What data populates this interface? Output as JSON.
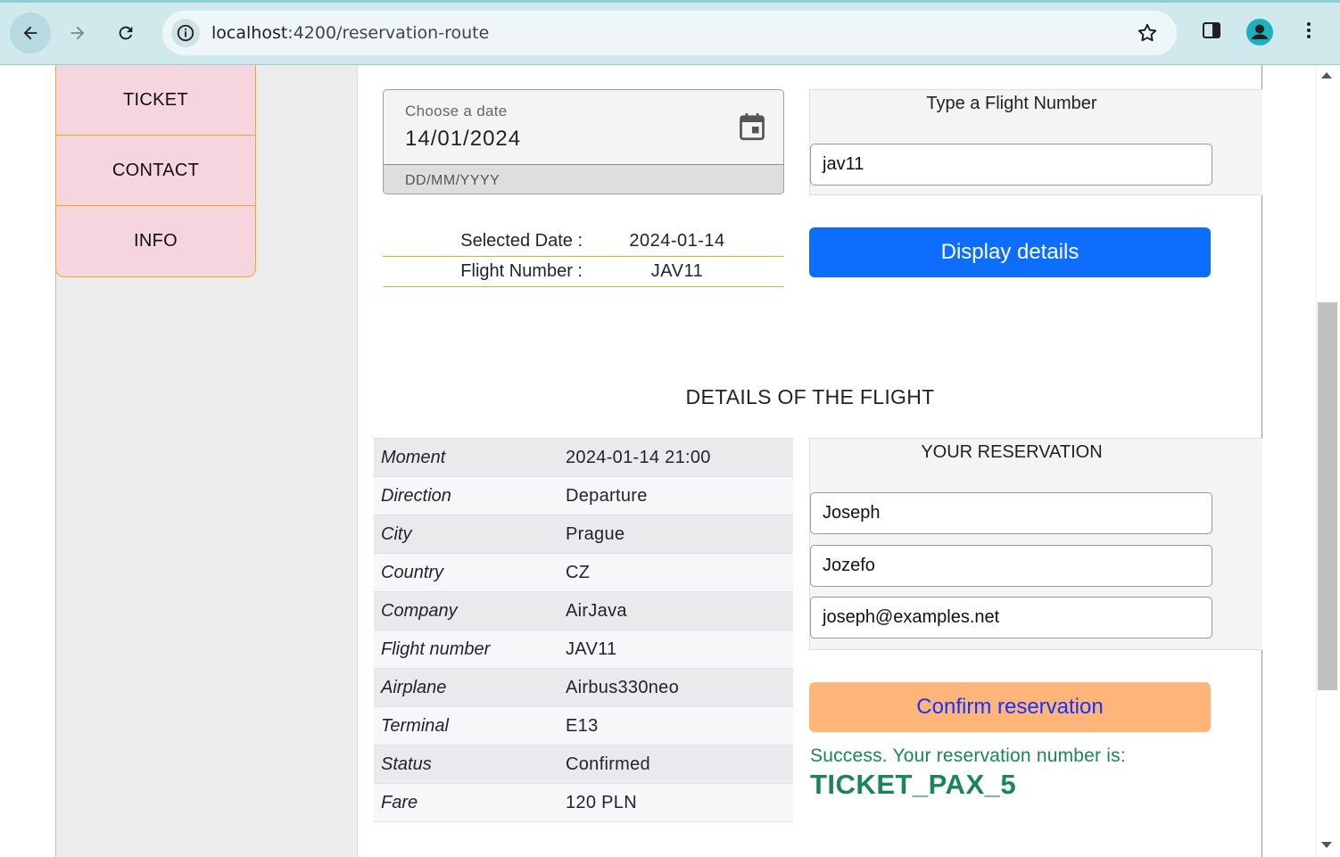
{
  "browser": {
    "url_host": "localhost",
    "url_path": ":4200/reservation-route"
  },
  "menu": {
    "items": [
      "TICKET",
      "CONTACT",
      "INFO"
    ]
  },
  "date_field": {
    "label": "Choose a date",
    "value": "14/01/2024",
    "hint": "DD/MM/YYYY"
  },
  "flight_search": {
    "title": "Type a Flight Number",
    "value": "jav11"
  },
  "summary": {
    "selected_date_label": "Selected Date :",
    "selected_date_value": "2024-01-14",
    "flight_number_label": "Flight Number :",
    "flight_number_value": "JAV11"
  },
  "display_button": "Display details",
  "details_title": "DETAILS OF THE FLIGHT",
  "details": [
    {
      "key": "Moment",
      "value": "2024-01-14 21:00"
    },
    {
      "key": "Direction",
      "value": "Departure"
    },
    {
      "key": "City",
      "value": "Prague"
    },
    {
      "key": "Country",
      "value": "CZ"
    },
    {
      "key": "Company",
      "value": "AirJava"
    },
    {
      "key": "Flight number",
      "value": "JAV11"
    },
    {
      "key": "Airplane",
      "value": "Airbus330neo"
    },
    {
      "key": "Terminal",
      "value": "E13"
    },
    {
      "key": "Status",
      "value": "Confirmed"
    },
    {
      "key": "Fare",
      "value": "120 PLN"
    }
  ],
  "reservation": {
    "title": "YOUR RESERVATION",
    "first_name": "Joseph",
    "last_name": "Jozefo",
    "email": "joseph@examples.net"
  },
  "confirm_button": "Confirm reservation",
  "success_message": "Success. Your reservation number is:",
  "ticket_number": "TICKET_PAX_5",
  "colors": {
    "primary_button": "#0d6efd",
    "confirm_button": "#ffb479",
    "success": "#198754",
    "menu_bg": "#f5d6df",
    "accent_border": "#f5a623"
  }
}
